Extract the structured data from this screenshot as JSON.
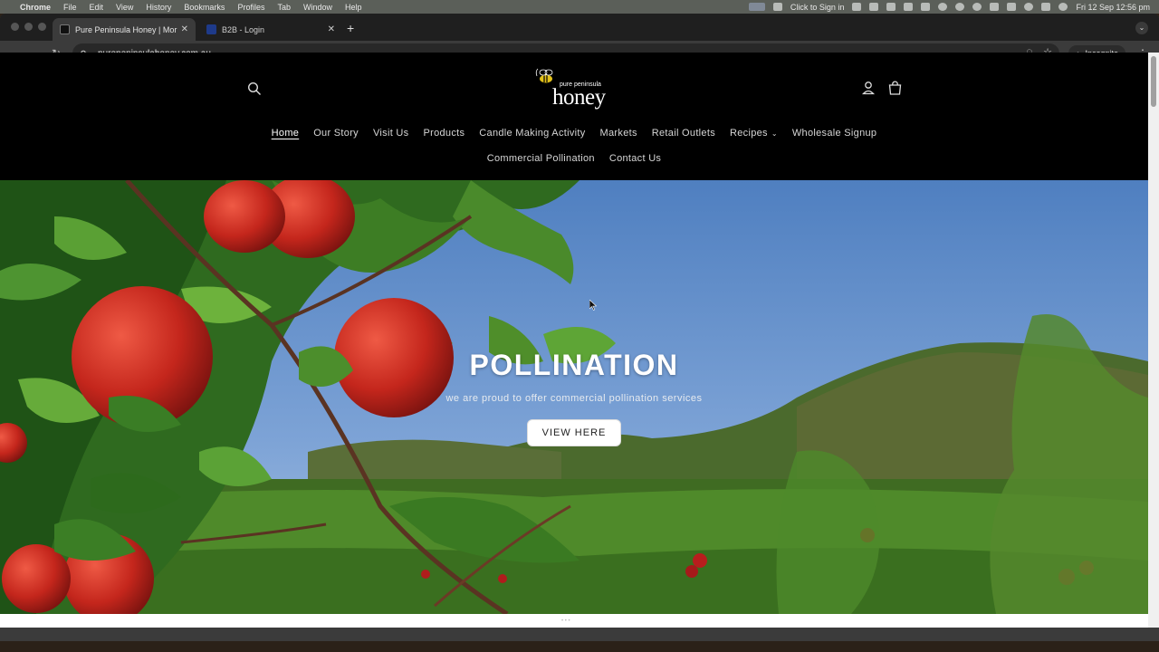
{
  "menubar": {
    "app": "Chrome",
    "items": [
      "File",
      "Edit",
      "View",
      "History",
      "Bookmarks",
      "Profiles",
      "Tab",
      "Window",
      "Help"
    ],
    "sign_in": "Click to Sign in",
    "datetime": "Fri 12 Sep  12:56 pm"
  },
  "tabs": [
    {
      "title": "Pure Peninsula Honey | Morni",
      "active": true
    },
    {
      "title": "B2B - Login",
      "active": false
    }
  ],
  "omnibox": {
    "url": "purepeninsulahoney.com.au"
  },
  "incognito_label": "Incognito",
  "logo": {
    "tagline": "pure peninsula",
    "word": "honey"
  },
  "nav": {
    "row1": [
      "Home",
      "Our Story",
      "Visit Us",
      "Products",
      "Candle Making Activity",
      "Markets",
      "Retail Outlets",
      "Recipes",
      "Wholesale Signup"
    ],
    "row2": [
      "Commercial Pollination",
      "Contact Us"
    ]
  },
  "hero": {
    "title": "POLLINATION",
    "subtitle": "we are proud to offer commercial pollination services",
    "button": "VIEW HERE"
  },
  "colors": {
    "header_bg": "#000000",
    "sky": "#5b87c4",
    "apple_red": "#c4261c",
    "leaf_green": "#3e7a2a"
  }
}
